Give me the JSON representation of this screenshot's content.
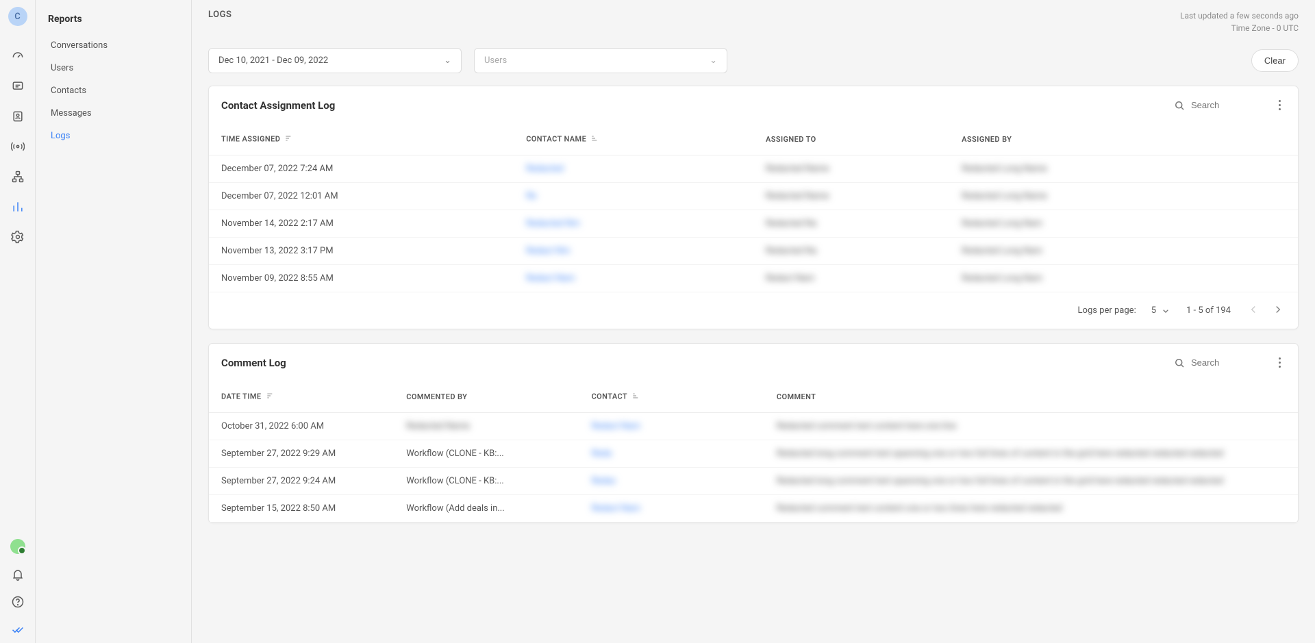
{
  "rail": {
    "avatar_letter": "C"
  },
  "sidebar": {
    "title": "Reports",
    "items": [
      {
        "label": "Conversations"
      },
      {
        "label": "Users"
      },
      {
        "label": "Contacts"
      },
      {
        "label": "Messages"
      },
      {
        "label": "Logs"
      }
    ]
  },
  "header": {
    "title": "LOGS",
    "last_updated": "Last updated a few seconds ago",
    "timezone": "Time Zone - 0 UTC"
  },
  "filters": {
    "date_range": "Dec 10, 2021 - Dec 09, 2022",
    "users_placeholder": "Users",
    "clear_label": "Clear"
  },
  "contact_log": {
    "title": "Contact Assignment Log",
    "search_placeholder": "Search",
    "columns": {
      "time": "TIME ASSIGNED",
      "name": "CONTACT NAME",
      "to": "ASSIGNED TO",
      "by": "ASSIGNED BY"
    },
    "rows": [
      {
        "time": "December 07, 2022 7:24 AM",
        "name": "Redacted",
        "to": "Redacted Name",
        "by": "Redacted Long Name"
      },
      {
        "time": "December 07, 2022 12:01 AM",
        "name": "Re",
        "to": "Redacted Name",
        "by": "Redacted Long Name"
      },
      {
        "time": "November 14, 2022 2:17 AM",
        "name": "Redacted Nm",
        "to": "Redacted Na",
        "by": "Redacted Long Nam"
      },
      {
        "time": "November 13, 2022 3:17 PM",
        "name": "Redact Nm",
        "to": "Redacted Na",
        "by": "Redacted Long Nam"
      },
      {
        "time": "November 09, 2022 8:55 AM",
        "name": "Redact Nam",
        "to": "Redact Nam",
        "by": "Redacted Long Nam"
      }
    ],
    "footer": {
      "per_page_label": "Logs per page:",
      "per_page_value": "5",
      "range": "1 - 5 of 194"
    }
  },
  "comment_log": {
    "title": "Comment Log",
    "search_placeholder": "Search",
    "columns": {
      "date": "DATE TIME",
      "by": "COMMENTED BY",
      "contact": "CONTACT",
      "comment": "COMMENT"
    },
    "rows": [
      {
        "date": "October 31, 2022 6:00 AM",
        "by": "Redacted Name",
        "by_blur": true,
        "contact": "Redact Nam",
        "comment": "Redacted comment text content here one line"
      },
      {
        "date": "September 27, 2022 9:29 AM",
        "by": "Workflow (CLONE - KB:...",
        "by_blur": false,
        "contact": "Reda",
        "comment": "Redacted long comment text spanning one or two full lines of content in the grid here redacted redacted redacted"
      },
      {
        "date": "September 27, 2022 9:24 AM",
        "by": "Workflow (CLONE - KB:...",
        "by_blur": false,
        "contact": "Redac",
        "comment": "Redacted long comment text spanning one or two full lines of content in the grid here redacted redacted redacted"
      },
      {
        "date": "September 15, 2022 8:50 AM",
        "by": "Workflow (Add deals in...",
        "by_blur": false,
        "contact": "Redact Nam",
        "comment": "Redacted comment text content one or two lines here redacted redacted"
      }
    ]
  }
}
